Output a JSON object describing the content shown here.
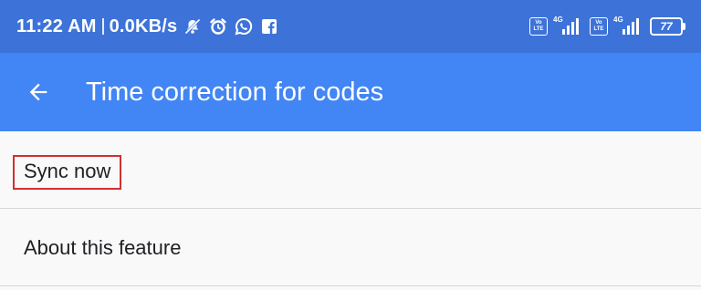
{
  "status_bar": {
    "time": "11:22 AM",
    "network_speed": "0.0KB/s",
    "icons": [
      "mute-icon",
      "alarm-icon",
      "whatsapp-icon",
      "facebook-icon"
    ],
    "volte_label_top": "Vo",
    "volte_label_bottom": "LTE",
    "network_type_1": "4G",
    "network_type_2": "4G",
    "battery": "77",
    "background_color": "#3d73d9"
  },
  "app_bar": {
    "back_icon": "arrow-back-icon",
    "title": "Time correction for codes",
    "background_color": "#4285f4"
  },
  "list": {
    "items": [
      {
        "label": "Sync now",
        "highlighted": true,
        "highlight_color": "#d32f2f"
      },
      {
        "label": "About this feature",
        "highlighted": false
      }
    ]
  }
}
